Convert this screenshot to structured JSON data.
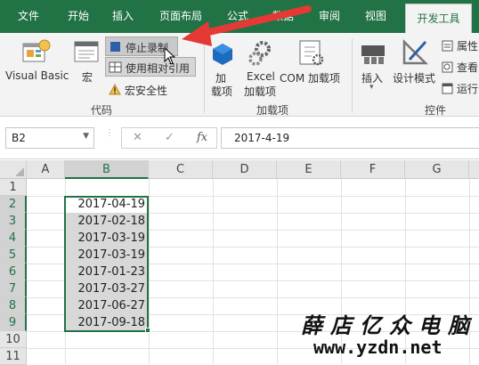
{
  "tabs": [
    "文件",
    "开始",
    "插入",
    "页面布局",
    "公式",
    "数据",
    "审阅",
    "视图",
    "开发工具"
  ],
  "ribbon": {
    "code_group": {
      "visual_basic": "Visual Basic",
      "macro": "宏",
      "stop_recording": "停止录制",
      "relative_ref": "使用相对引用",
      "macro_security": "宏安全性",
      "label": "代码"
    },
    "addins_group": {
      "addins": [
        "加",
        "载项"
      ],
      "excel_addins": [
        "Excel",
        "加载项"
      ],
      "com_addins": "COM 加载项",
      "label": "加载项"
    },
    "controls_group": {
      "insert": "插入",
      "design_mode": "设计模式",
      "properties": "属性",
      "view_code": "查看",
      "run_dialog": "运行",
      "label": "控件"
    }
  },
  "formula_bar": {
    "name_box": "B2",
    "cancel": "✕",
    "enter": "✓",
    "fx": "fx",
    "value": "2017-4-19"
  },
  "sheet": {
    "columns": [
      "A",
      "B",
      "C",
      "D",
      "E",
      "F",
      "G"
    ],
    "rows": [
      "1",
      "2",
      "3",
      "4",
      "5",
      "6",
      "7",
      "8",
      "9",
      "10",
      "11"
    ],
    "b_values": [
      "2017-04-19",
      "2017-02-18",
      "2017-03-19",
      "2017-03-19",
      "2017-01-23",
      "2017-03-27",
      "2017-06-27",
      "2017-09-18"
    ]
  },
  "watermark": {
    "line1": "薛店亿众电脑",
    "line2": "www.yzdn.net"
  },
  "colors": {
    "accent": "#217346",
    "arrow": "#e53935"
  }
}
